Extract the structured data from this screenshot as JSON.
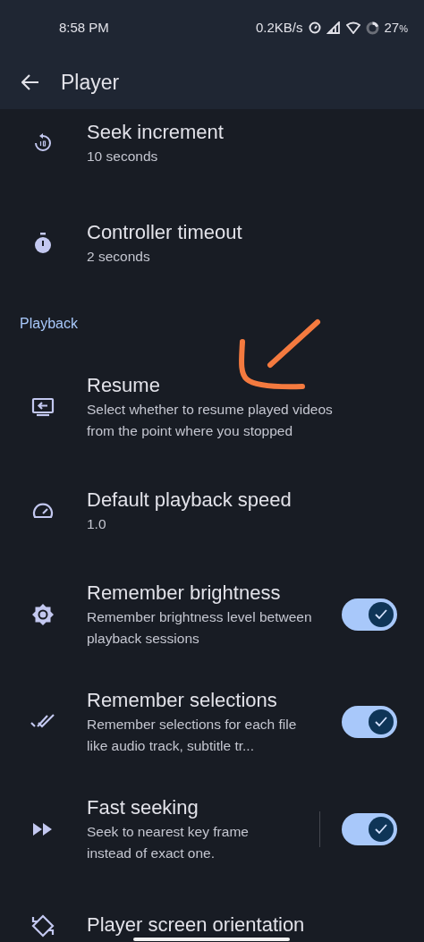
{
  "status_bar": {
    "time": "8:58 PM",
    "network_speed": "0.2KB/s",
    "battery": "27",
    "battery_unit": "%"
  },
  "toolbar": {
    "title": "Player"
  },
  "sections": [
    {
      "items": [
        {
          "kind": "setting",
          "title": "Seek increment",
          "subtitle": "10 seconds"
        },
        {
          "kind": "setting",
          "title": "Controller timeout",
          "subtitle": "2 seconds"
        }
      ]
    },
    {
      "header": "Playback",
      "items": [
        {
          "kind": "setting",
          "title": "Resume",
          "subtitle": "Select whether to resume played videos from the point where you stopped"
        },
        {
          "kind": "setting",
          "title": "Default playback speed",
          "subtitle": "1.0"
        },
        {
          "kind": "switch",
          "title": "Remember brightness",
          "subtitle": "Remember brightness level between playback sessions",
          "on": true
        },
        {
          "kind": "switch",
          "title": "Remember selections",
          "subtitle": "Remember selections for each file like audio track, subtitle tr...",
          "on": true
        },
        {
          "kind": "split-switch",
          "title": "Fast seeking",
          "subtitle": "Seek to nearest key frame instead of exact one.",
          "on": true
        },
        {
          "kind": "setting",
          "title": "Player screen orientation"
        }
      ]
    }
  ]
}
